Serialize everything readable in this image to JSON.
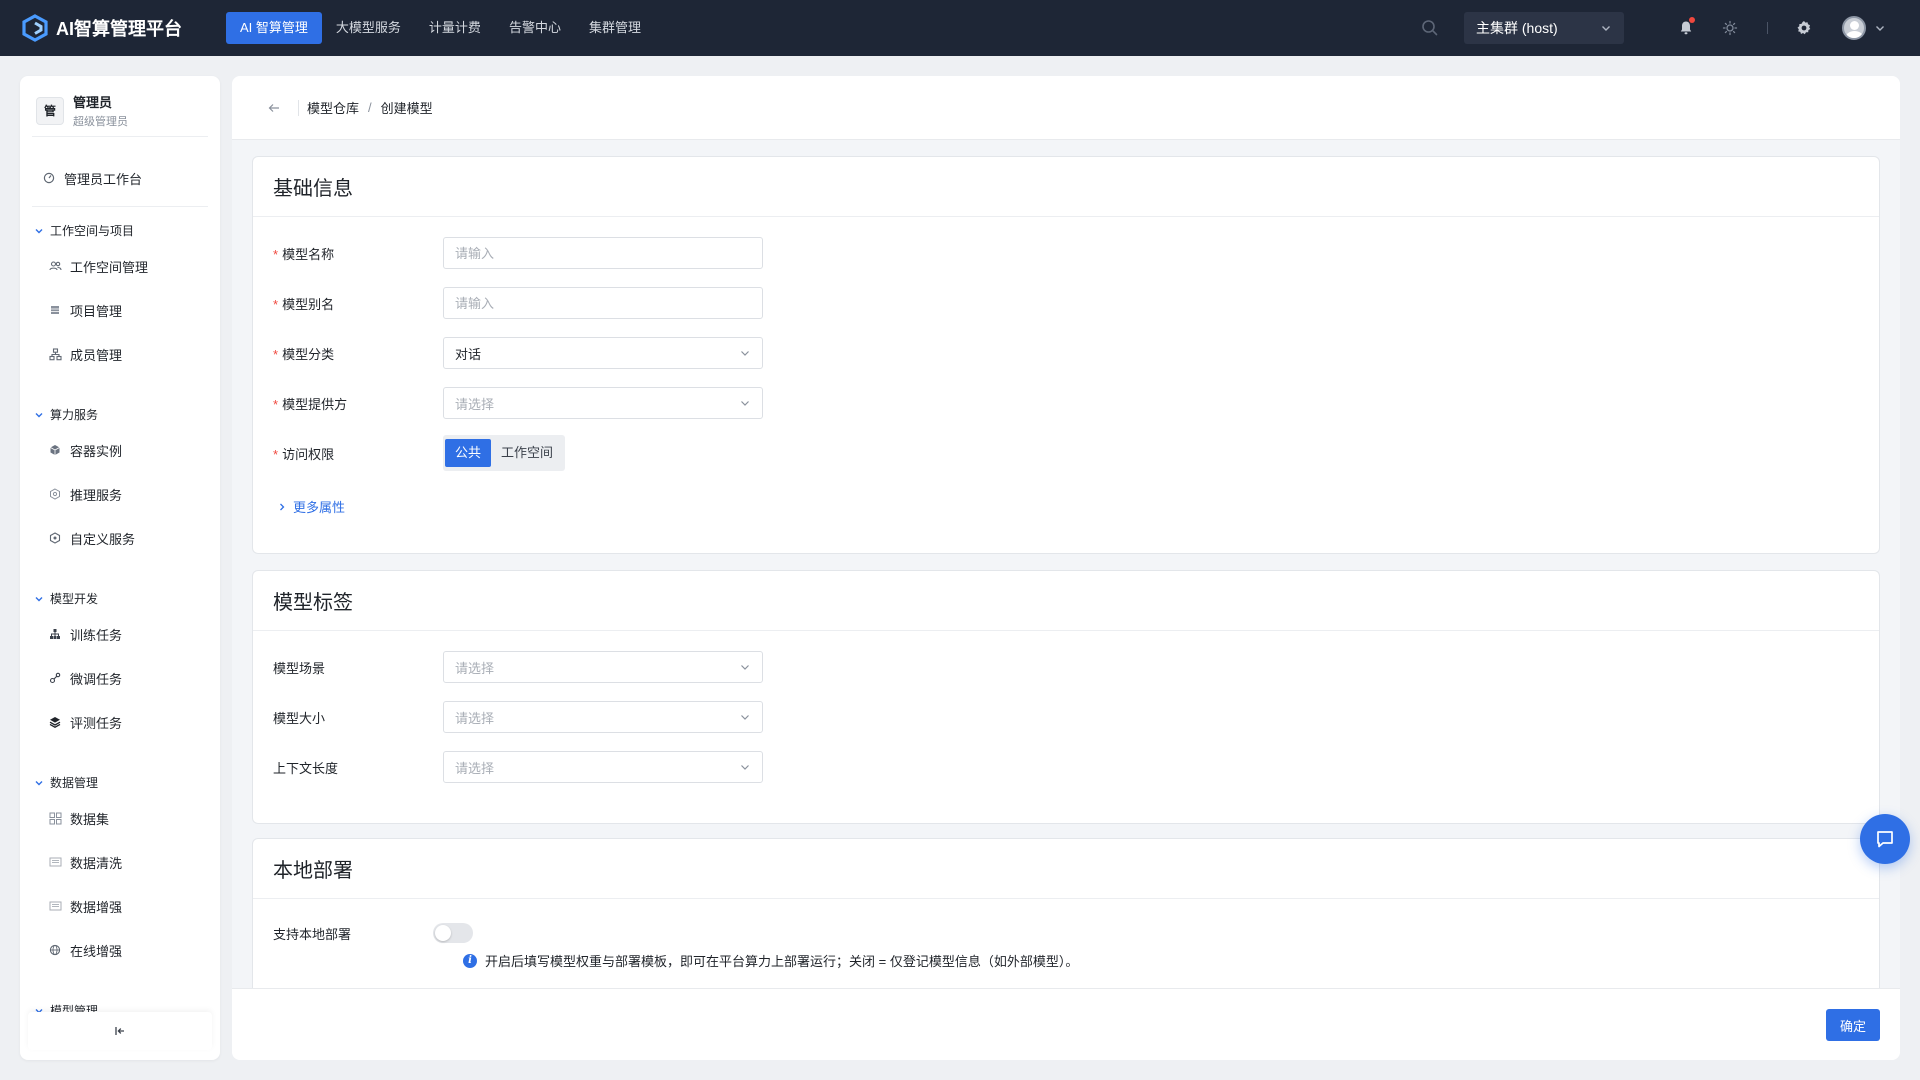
{
  "app": {
    "title": "AI智算管理平台"
  },
  "nav": {
    "items": [
      {
        "label": "AI 智算管理",
        "active": true
      },
      {
        "label": "大模型服务",
        "active": false
      },
      {
        "label": "计量计费",
        "active": false
      },
      {
        "label": "告警中心",
        "active": false
      },
      {
        "label": "集群管理",
        "active": false
      }
    ]
  },
  "topbar": {
    "cluster": "主集群 (host)"
  },
  "user": {
    "badge": "管",
    "name": "管理员",
    "role": "超级管理员"
  },
  "sidebar": {
    "workbench": "管理员工作台",
    "groups": [
      {
        "label": "工作空间与项目",
        "items": [
          "工作空间管理",
          "项目管理",
          "成员管理"
        ]
      },
      {
        "label": "算力服务",
        "items": [
          "容器实例",
          "推理服务",
          "自定义服务"
        ]
      },
      {
        "label": "模型开发",
        "items": [
          "训练任务",
          "微调任务",
          "评测任务"
        ]
      },
      {
        "label": "数据管理",
        "items": [
          "数据集",
          "数据清洗",
          "数据增强",
          "在线增强"
        ]
      },
      {
        "label": "模型管理",
        "items": []
      }
    ],
    "collapse_icon": "collapse-left-icon"
  },
  "breadcrumb": {
    "parent": "模型仓库",
    "separator": "/",
    "current": "创建模型"
  },
  "basic": {
    "title": "基础信息",
    "required_mark": "*",
    "name_label": "模型名称",
    "name_placeholder": "请输入",
    "alias_label": "模型别名",
    "alias_placeholder": "请输入",
    "category_label": "模型分类",
    "category_value": "对话",
    "provider_label": "模型提供方",
    "provider_placeholder": "请选择",
    "access_label": "访问权限",
    "access_options": [
      "公共",
      "工作空间"
    ],
    "access_selected": "公共",
    "more_label": "更多属性"
  },
  "tags": {
    "title": "模型标签",
    "scene_label": "模型场景",
    "scene_placeholder": "请选择",
    "size_label": "模型大小",
    "size_placeholder": "请选择",
    "context_label": "上下文长度",
    "context_placeholder": "请选择"
  },
  "deploy": {
    "title": "本地部署",
    "support_label": "支持本地部署",
    "enabled": false,
    "hint": "开启后填写模型权重与部署模板，即可在平台算力上部署运行；关闭 = 仅登记模型信息（如外部模型）。"
  },
  "footer": {
    "confirm_label": "确定"
  },
  "colors": {
    "primary": "#2f6fe5",
    "topbar": "#1e2636",
    "required": "#f0483e"
  }
}
